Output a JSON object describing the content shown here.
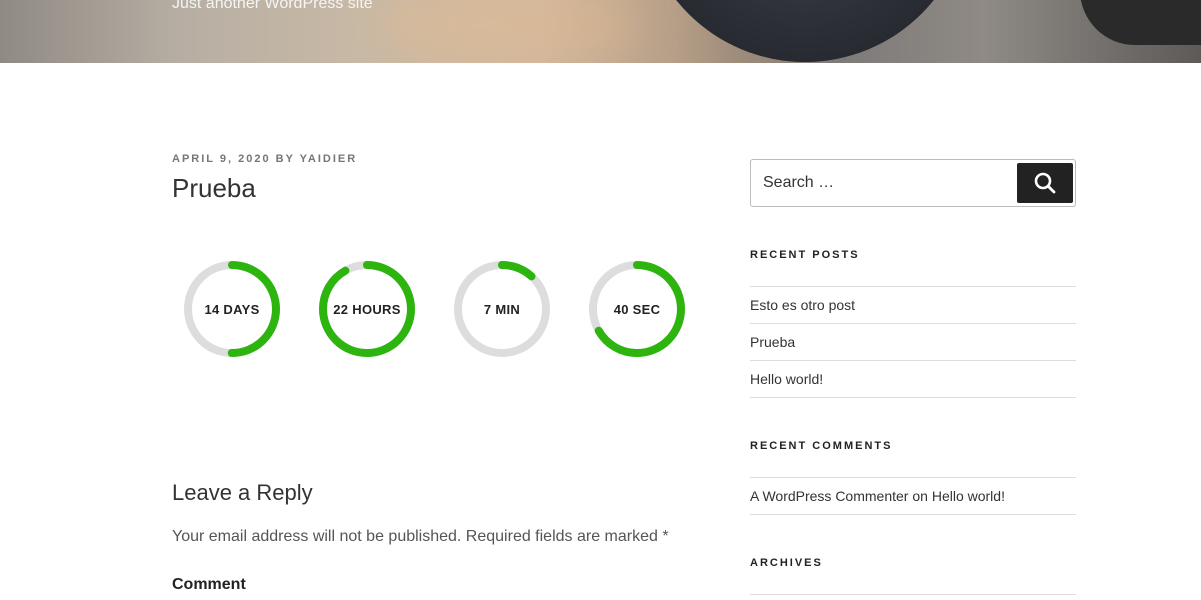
{
  "site": {
    "tagline": "Just another WordPress site"
  },
  "post": {
    "date": "APRIL 9, 2020",
    "by": "BY",
    "author": "YAIDIER",
    "title": "Prueba"
  },
  "countdown": {
    "colors": {
      "progress": "#2db40f",
      "track": "#dddddd"
    },
    "timers": [
      {
        "label": "14 DAYS",
        "value": 14,
        "max": 28
      },
      {
        "label": "22 HOURS",
        "value": 22,
        "max": 24
      },
      {
        "label": "7 MIN",
        "value": 7,
        "max": 60
      },
      {
        "label": "40 SEC",
        "value": 40,
        "max": 60
      }
    ]
  },
  "reply": {
    "title": "Leave a Reply",
    "note": "Your email address will not be published. Required fields are marked *",
    "comment_label": "Comment"
  },
  "sidebar": {
    "search": {
      "placeholder": "Search …",
      "button_icon": "search-icon"
    },
    "recent_posts": {
      "title": "RECENT POSTS",
      "items": [
        "Esto es otro post",
        "Prueba",
        "Hello world!"
      ]
    },
    "recent_comments": {
      "title": "RECENT COMMENTS",
      "items": [
        {
          "author": "A WordPress Commenter",
          "on": "on",
          "post": "Hello world!"
        }
      ]
    },
    "archives": {
      "title": "ARCHIVES"
    }
  }
}
